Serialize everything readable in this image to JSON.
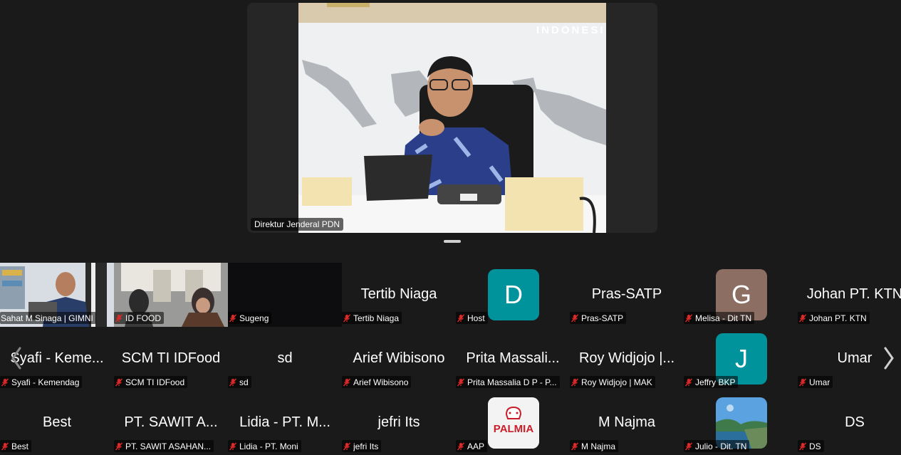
{
  "speaker": {
    "name": "Direktur Jenderal PDN",
    "wall_text": "INDONESI"
  },
  "colors": {
    "background": "#1a1a1a",
    "avatar_teal": "#00939c",
    "avatar_brown": "#8d6e63",
    "mute_red": "#e02828"
  },
  "tiles": [
    {
      "label": "Sahat M Sinaga | GIMNI",
      "muted": false,
      "kind": "video"
    },
    {
      "label": "ID FOOD",
      "muted": true,
      "kind": "video"
    },
    {
      "label": "Sugeng",
      "muted": true,
      "kind": "dark"
    },
    {
      "display": "Tertib Niaga",
      "label": "Tertib Niaga",
      "muted": true,
      "kind": "name"
    },
    {
      "avatar": "D",
      "label": "Host",
      "muted": true,
      "kind": "avatar",
      "avatar_color": "#00939c"
    },
    {
      "display": "Pras-SATP",
      "label": "Pras-SATP",
      "muted": true,
      "kind": "name"
    },
    {
      "avatar": "G",
      "label": "Melisa - Dit TN",
      "muted": true,
      "kind": "avatar",
      "avatar_color": "#8d6e63"
    },
    {
      "display": "Johan PT. KTN",
      "label": "Johan PT. KTN",
      "muted": true,
      "kind": "name"
    },
    {
      "display": "Syafi - Keme...",
      "label": "Syafi - Kemendag",
      "muted": true,
      "kind": "name"
    },
    {
      "display": "SCM TI IDFood",
      "label": "SCM TI IDFood",
      "muted": true,
      "kind": "name"
    },
    {
      "display": "sd",
      "label": "sd",
      "muted": true,
      "kind": "name"
    },
    {
      "display": "Arief Wibisono",
      "label": "Arief Wibisono",
      "muted": true,
      "kind": "name"
    },
    {
      "display": "Prita Massali...",
      "label": "Prita Massalia D P - P...",
      "muted": true,
      "kind": "name"
    },
    {
      "display": "Roy Widjojo |...",
      "label": "Roy Widjojo | MAK",
      "muted": true,
      "kind": "name"
    },
    {
      "avatar": "J",
      "label": "Jeffry BKP",
      "muted": true,
      "kind": "avatar",
      "avatar_color": "#00939c"
    },
    {
      "display": "Umar",
      "label": "Umar",
      "muted": true,
      "kind": "name"
    },
    {
      "display": "Best",
      "label": "Best",
      "muted": true,
      "kind": "name"
    },
    {
      "display": "PT. SAWIT A...",
      "label": "PT. SAWIT ASAHAN...",
      "muted": true,
      "kind": "name"
    },
    {
      "display": "Lidia - PT. M...",
      "label": "Lidia - PT. Moni",
      "muted": true,
      "kind": "name"
    },
    {
      "display": "jefri Its",
      "label": "jefri Its",
      "muted": true,
      "kind": "name"
    },
    {
      "avatar_logo": "PALMIA",
      "label": "AAP",
      "muted": true,
      "kind": "logo"
    },
    {
      "display": "M Najma",
      "label": "M Najma",
      "muted": true,
      "kind": "name"
    },
    {
      "label": "Julio - Dit. TN",
      "muted": true,
      "kind": "photo"
    },
    {
      "display": "DS",
      "label": "DS",
      "muted": true,
      "kind": "name"
    }
  ]
}
